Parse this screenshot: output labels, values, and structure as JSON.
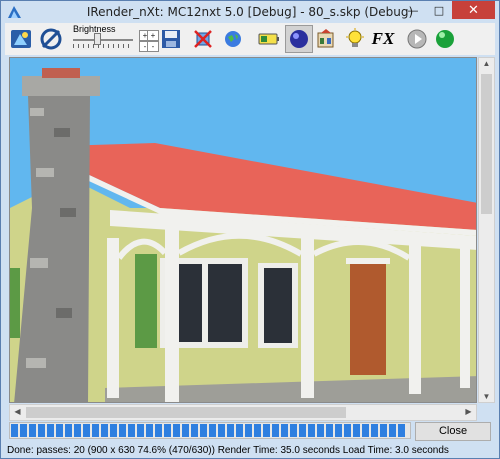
{
  "window": {
    "title": "IRender_nXt: MC12nxt 5.0 [Debug] - 80_s.skp (Debug)",
    "minimize_glyph": "—",
    "maximize_glyph": "□",
    "close_glyph": "✕"
  },
  "toolbar": {
    "brightness_label": "Brightness",
    "spin_up": "+",
    "spin_down": "-",
    "fx_label": "FX",
    "buttons": [
      {
        "icon": "render-icon"
      },
      {
        "icon": "refresh-icon"
      },
      {
        "icon": "save-icon"
      },
      {
        "icon": "crop-icon"
      },
      {
        "icon": "globe-icon"
      },
      {
        "icon": "battery-icon"
      },
      {
        "icon": "sphere-icon",
        "pressed": true
      },
      {
        "icon": "materials-icon"
      },
      {
        "icon": "lightbulb-icon"
      },
      {
        "icon": "fx-icon"
      },
      {
        "icon": "play-icon"
      },
      {
        "icon": "green-ball-icon"
      }
    ]
  },
  "render": {
    "sky_color": "#61b7ef",
    "roof_color": "#e86459",
    "siding_color": "#cfd48a",
    "trim_color": "#f1f1ee",
    "door_color": "#b05a2e",
    "shutter_color": "#5c9a45",
    "stone_color": "#8a8a88"
  },
  "progress": {
    "fraction": 0.99
  },
  "close_label": "Close",
  "status_text": "Done: passes: 20 (900 x 630 74.6% (470/630))  Render Time: 35.0 seconds Load Time: 3.0 seconds"
}
